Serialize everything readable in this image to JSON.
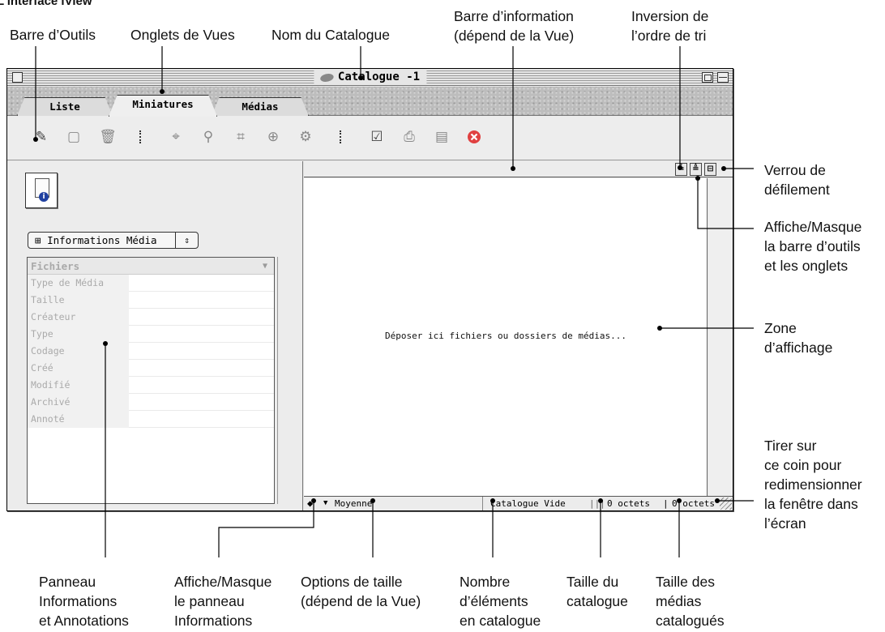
{
  "heading": "L'interface iView",
  "annotations": {
    "barre_outils": "Barre d’Outils",
    "onglets_vues": "Onglets de Vues",
    "nom_catalogue": "Nom du Catalogue",
    "barre_info_1": "Barre d’information",
    "barre_info_2": "(dépend de la Vue)",
    "inversion_1": "Inversion de",
    "inversion_2": "l’ordre de tri",
    "verrou_1": "Verrou de",
    "verrou_2": "défilement",
    "affiche_barre_1": "Affiche/Masque",
    "affiche_barre_2": "la barre d’outils",
    "affiche_barre_3": "et les onglets",
    "zone_1": "Zone",
    "zone_2": "d’affichage",
    "tirer_1": "Tirer sur",
    "tirer_2": "ce coin pour",
    "tirer_3": "redimensionner",
    "tirer_4": "la fenêtre dans",
    "tirer_5": "l’écran",
    "panneau_1": "Panneau",
    "panneau_2": "Informations",
    "panneau_3": "et Annotations",
    "affiche_panneau_1": "Affiche/Masque",
    "affiche_panneau_2": "le panneau",
    "affiche_panneau_3": "Informations",
    "options_1": "Options de taille",
    "options_2": "(dépend de la Vue)",
    "nombre_1": "Nombre",
    "nombre_2": "d’éléments",
    "nombre_3": "en catalogue",
    "taille_cat_1": "Taille du",
    "taille_cat_2": "catalogue",
    "taille_med_1": "Taille des",
    "taille_med_2": "médias",
    "taille_med_3": "catalogués"
  },
  "window": {
    "title": "Catalogue -1",
    "tabs": [
      "Liste",
      "Miniatures",
      "Médias"
    ],
    "active_tab": "Miniatures",
    "toolbar_icons": [
      "add-media-icon",
      "new-catalog-icon",
      "trash-icon",
      "tag-icon",
      "find-icon",
      "crop-icon",
      "rotate-icon",
      "convert-icon",
      "check-icon",
      "print-icon",
      "slideshow-icon",
      "stop-icon"
    ],
    "info_select": "Informations Média",
    "info_table": {
      "header": "Fichiers",
      "rows": [
        "Type de Média",
        "Taille",
        "Créateur",
        "Type",
        "Codage",
        "Créé",
        "Modifié",
        "Archivé",
        "Annoté"
      ]
    },
    "drop_text": "Déposer ici fichiers ou dossiers de médias...",
    "status": {
      "toggle_glyph": "◆",
      "size_option": "Moyenne",
      "count": "Catalogue Vide",
      "catalog_size": "0 octets",
      "media_size": "0 octets"
    }
  },
  "colors": {
    "window_bg": "#e6e6e6",
    "display_bg": "#ffffff",
    "stop_icon": "#e04040"
  }
}
